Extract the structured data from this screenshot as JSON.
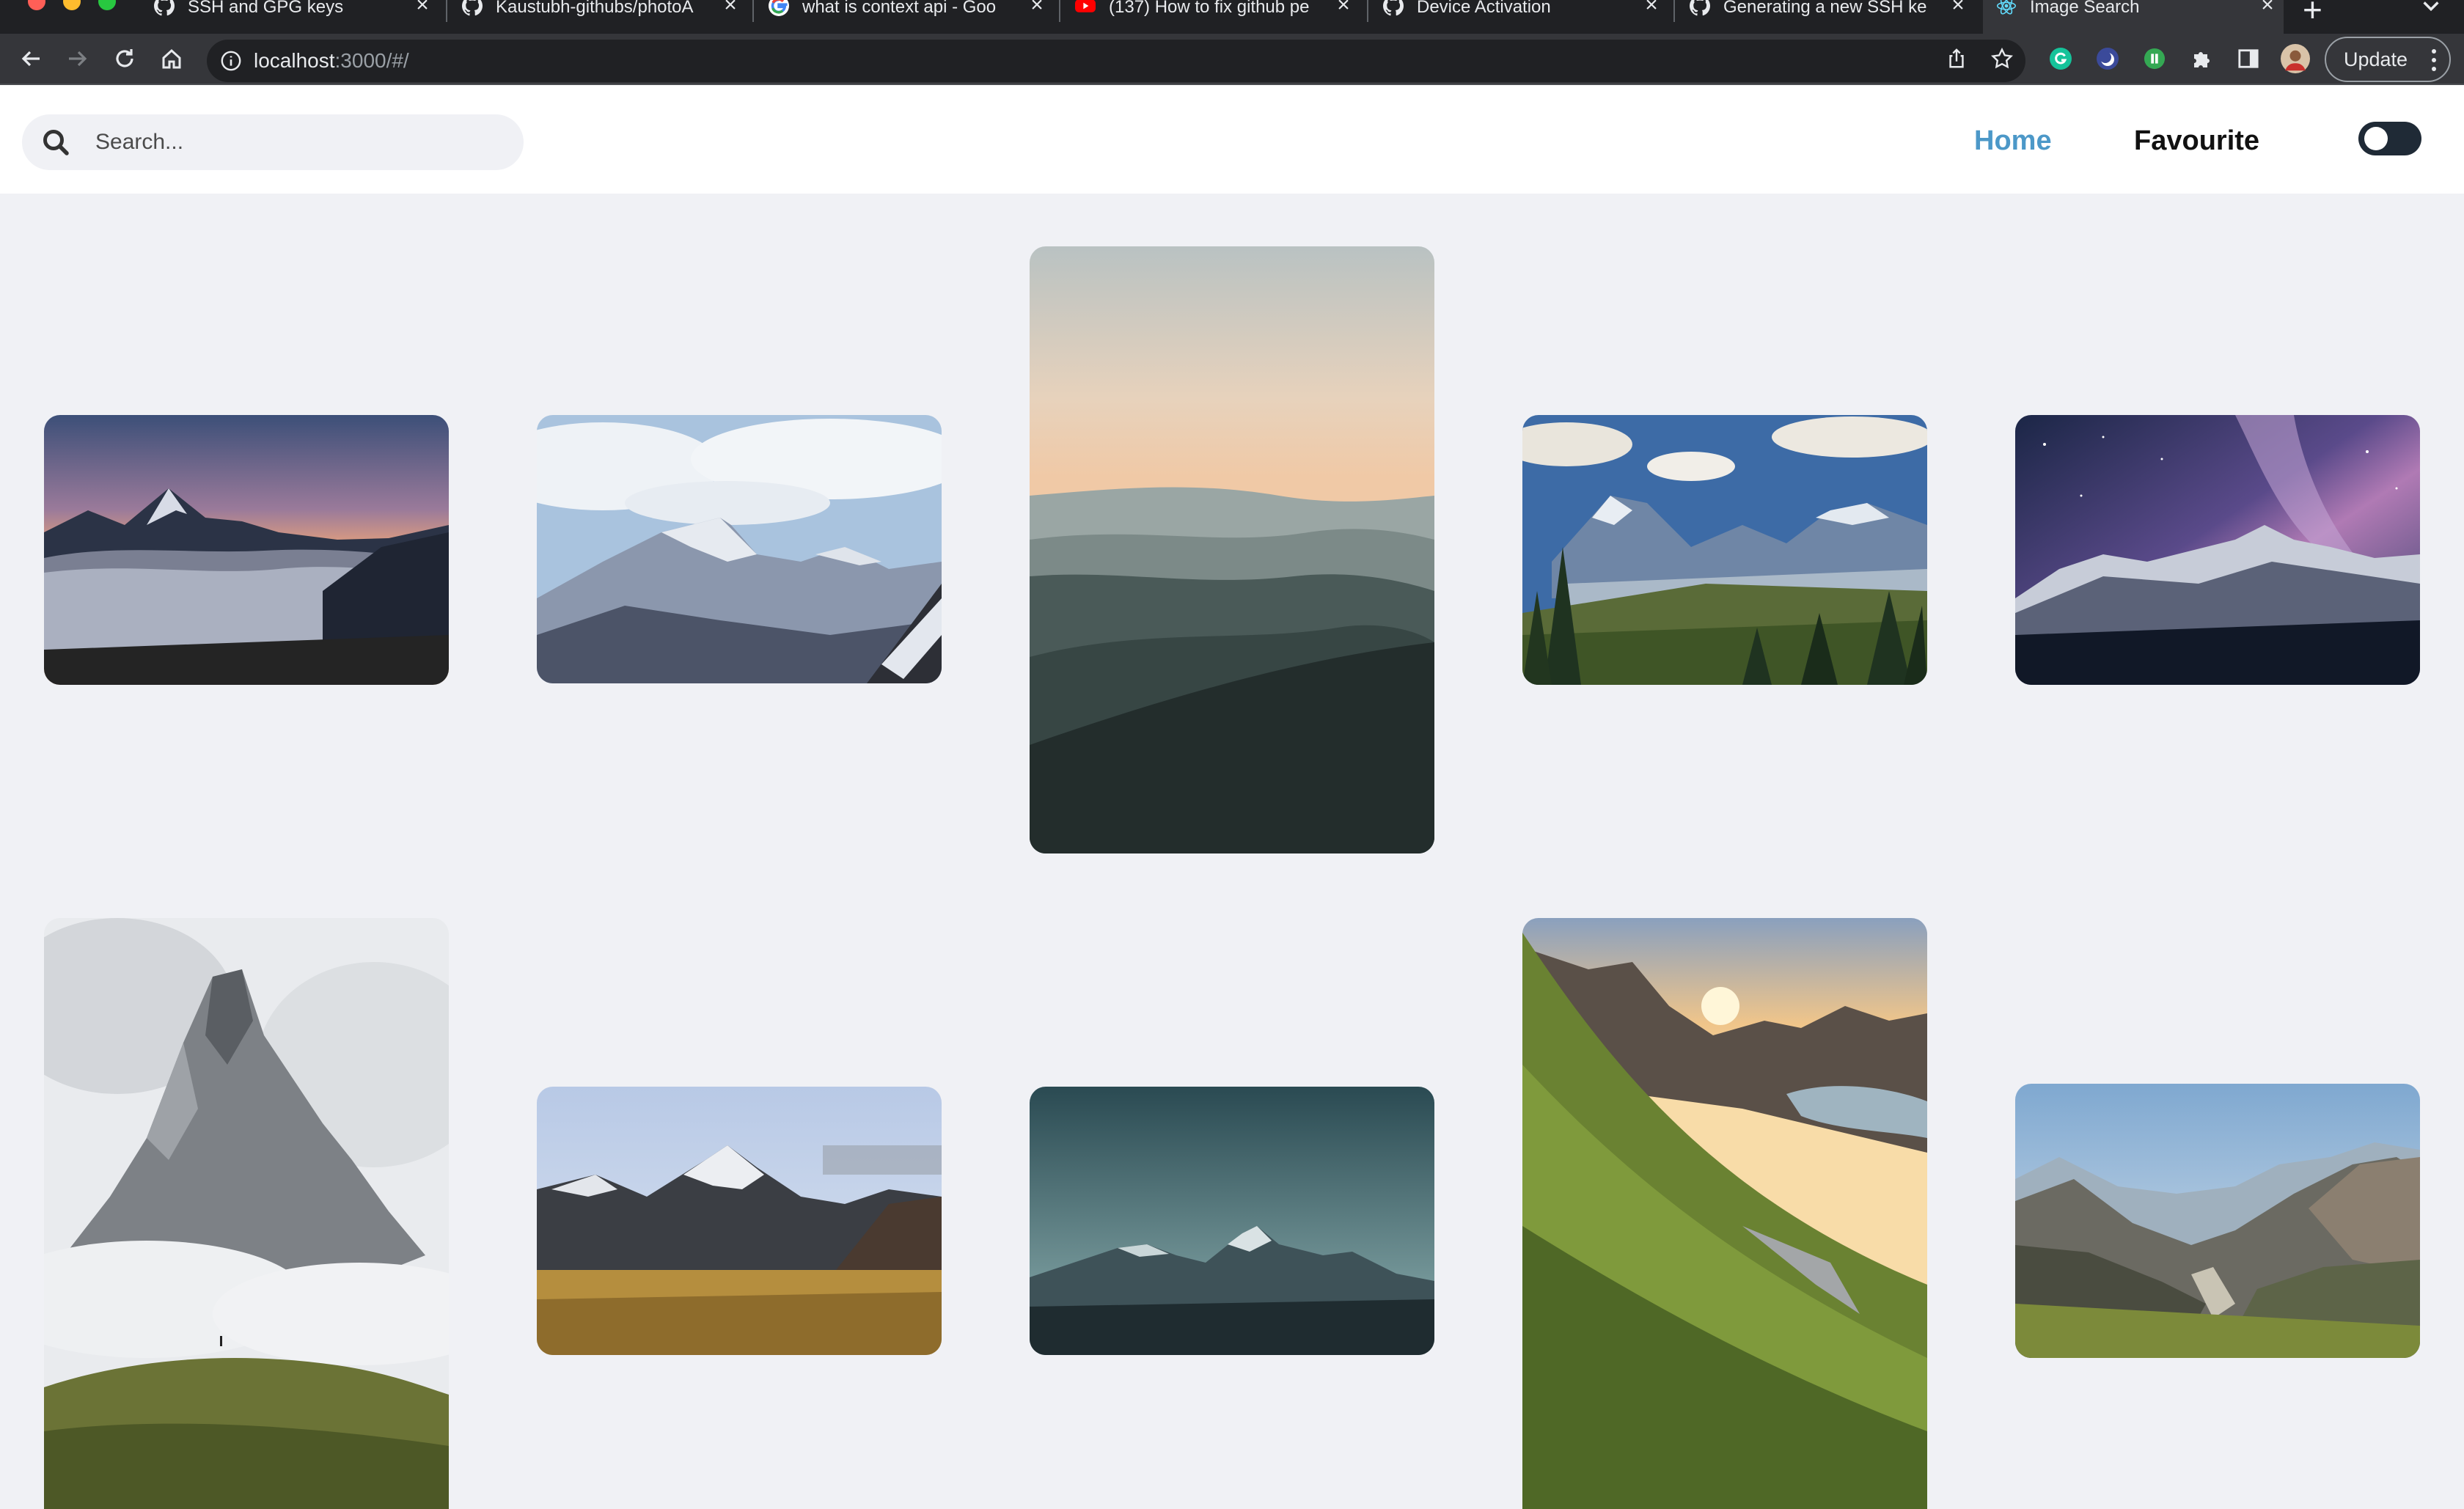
{
  "browser": {
    "tabs": [
      {
        "title": "SSH and GPG keys",
        "icon": "github-icon"
      },
      {
        "title": "Kaustubh-githubs/photoA",
        "icon": "github-icon"
      },
      {
        "title": "what is context api - Goo",
        "icon": "google-icon"
      },
      {
        "title": "(137) How to fix github pe",
        "icon": "youtube-icon"
      },
      {
        "title": "Device Activation",
        "icon": "github-icon"
      },
      {
        "title": "Generating a new SSH ke",
        "icon": "github-icon"
      },
      {
        "title": "Image Search",
        "icon": "react-icon"
      }
    ],
    "url_host": "localhost",
    "url_rest": ":3000/#/",
    "update_label": "Update"
  },
  "app": {
    "search_placeholder": "Search...",
    "nav": {
      "home": "Home",
      "favourite": "Favourite"
    },
    "theme_toggle": "off"
  },
  "gallery": {
    "photos": [
      {
        "subject": "alpine ridge above sea of clouds at sunset"
      },
      {
        "subject": "snowy himalayan peak with blue sky"
      },
      {
        "subject": "layered misty hills at dawn"
      },
      {
        "subject": "valley with pine trees and mountains"
      },
      {
        "subject": "milky way over snowy mountains"
      },
      {
        "subject": "rocky peak in clouds with hiker"
      },
      {
        "subject": "snow capped peak above golden grassland"
      },
      {
        "subject": "teal sky over mountain silhouette"
      },
      {
        "subject": "green mountainside with sunburst over lake"
      },
      {
        "subject": "rugged valley with distant peaks"
      }
    ]
  },
  "colors": {
    "accent": "#4c98c8",
    "page_bg": "#f0f1f5",
    "header_bg": "#ffffff"
  }
}
